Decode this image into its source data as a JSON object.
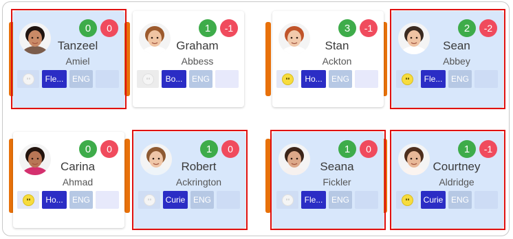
{
  "cards": [
    {
      "id": "tanzeel",
      "first": "Tanzeel",
      "last": "Amiel",
      "pos": "0",
      "neg": "0",
      "house": "Fle...",
      "lang": "ENG",
      "emoji": "faint",
      "selected": true,
      "avatar": {
        "skin": "#c98a67",
        "hair": "#1f1410",
        "shirt": "#7b5d4c"
      }
    },
    {
      "id": "graham",
      "first": "Graham",
      "last": "Abbess",
      "pos": "1",
      "neg": "-1",
      "house": "Bo...",
      "lang": "ENG",
      "emoji": "faint",
      "selected": false,
      "avatar": {
        "skin": "#f0c4a2",
        "hair": "#9c5a2d",
        "shirt": "#ffffff"
      }
    },
    {
      "id": "stan",
      "first": "Stan",
      "last": "Ackton",
      "pos": "3",
      "neg": "-1",
      "house": "Ho...",
      "lang": "ENG",
      "emoji": "on",
      "selected": false,
      "avatar": {
        "skin": "#f1c9ab",
        "hair": "#c0542a",
        "shirt": "#ffffff"
      }
    },
    {
      "id": "sean",
      "first": "Sean",
      "last": "Abbey",
      "pos": "2",
      "neg": "-2",
      "house": "Fle...",
      "lang": "ENG",
      "emoji": "on",
      "selected": true,
      "avatar": {
        "skin": "#efc3a3",
        "hair": "#3a2a20",
        "shirt": "#ffffff"
      }
    },
    {
      "id": "carina",
      "first": "Carina",
      "last": "Ahmad",
      "pos": "0",
      "neg": "0",
      "house": "Ho...",
      "lang": "ENG",
      "emoji": "on",
      "selected": false,
      "avatar": {
        "skin": "#b87756",
        "hair": "#22140e",
        "shirt": "#d4306e"
      }
    },
    {
      "id": "robert",
      "first": "Robert",
      "last": "Ackrington",
      "pos": "1",
      "neg": "0",
      "house": "Curie",
      "lang": "ENG",
      "emoji": "faint",
      "selected": true,
      "avatar": {
        "skin": "#efc6a8",
        "hair": "#8e5a32",
        "shirt": "#eef4f9"
      }
    },
    {
      "id": "seana",
      "first": "Seana",
      "last": "Fickler",
      "pos": "1",
      "neg": "0",
      "house": "Fle...",
      "lang": "ENG",
      "emoji": "faint",
      "selected": true,
      "avatar": {
        "skin": "#dca889",
        "hair": "#3b2418",
        "shirt": "#f6f1ef"
      }
    },
    {
      "id": "courtney",
      "first": "Courtney",
      "last": "Aldridge",
      "pos": "1",
      "neg": "-1",
      "house": "Curie",
      "lang": "ENG",
      "emoji": "on",
      "selected": true,
      "avatar": {
        "skin": "#e8b898",
        "hair": "#4d2e1c",
        "shirt": "#fbf4f0"
      }
    }
  ]
}
